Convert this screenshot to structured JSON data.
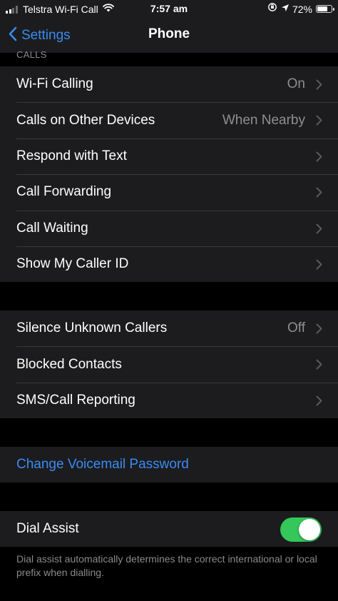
{
  "status_bar": {
    "carrier": "Telstra Wi-Fi Call",
    "time": "7:57 am",
    "battery_percent": "72%",
    "battery_level": 0.72,
    "signal_bars": 2
  },
  "nav": {
    "back_label": "Settings",
    "title": "Phone"
  },
  "calls_section": {
    "header": "CALLS",
    "items": [
      {
        "label": "Wi-Fi Calling",
        "value": "On"
      },
      {
        "label": "Calls on Other Devices",
        "value": "When Nearby"
      },
      {
        "label": "Respond with Text",
        "value": ""
      },
      {
        "label": "Call Forwarding",
        "value": ""
      },
      {
        "label": "Call Waiting",
        "value": ""
      },
      {
        "label": "Show My Caller ID",
        "value": ""
      }
    ]
  },
  "privacy_section": {
    "items": [
      {
        "label": "Silence Unknown Callers",
        "value": "Off"
      },
      {
        "label": "Blocked Contacts",
        "value": ""
      },
      {
        "label": "SMS/Call Reporting",
        "value": ""
      }
    ]
  },
  "voicemail": {
    "change_password_label": "Change Voicemail Password"
  },
  "dial_assist": {
    "label": "Dial Assist",
    "enabled": true,
    "footer": "Dial assist automatically determines the correct international or local prefix when dialling."
  },
  "colors": {
    "accent": "#3a8bf2",
    "toggle_on": "#34c759",
    "cell_background": "#1c1c1e",
    "page_background": "#000000"
  }
}
